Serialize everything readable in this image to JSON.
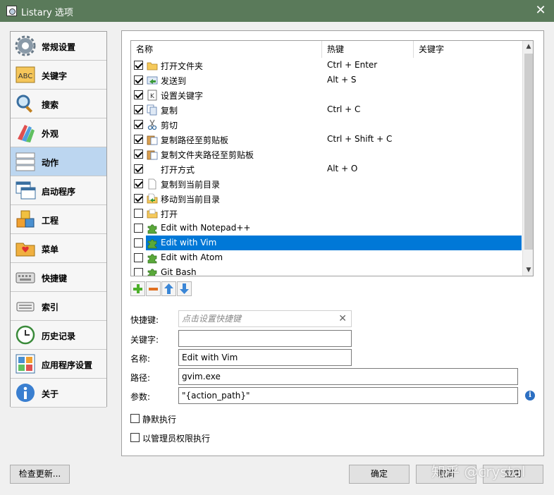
{
  "window": {
    "title": "Listary 选项",
    "close_glyph": "✕"
  },
  "sidebar": {
    "items": [
      {
        "label": "常规设置",
        "icon": "gear-icon"
      },
      {
        "label": "关键字",
        "icon": "abc-icon"
      },
      {
        "label": "搜索",
        "icon": "magnifier-icon"
      },
      {
        "label": "外观",
        "icon": "palette-icon"
      },
      {
        "label": "动作",
        "icon": "action-list-icon"
      },
      {
        "label": "启动程序",
        "icon": "windows-icon"
      },
      {
        "label": "工程",
        "icon": "boxes-icon"
      },
      {
        "label": "菜单",
        "icon": "folder-heart-icon"
      },
      {
        "label": "快捷键",
        "icon": "keyboard-icon"
      },
      {
        "label": "索引",
        "icon": "index-icon"
      },
      {
        "label": "历史记录",
        "icon": "clock-icon"
      },
      {
        "label": "应用程序设置",
        "icon": "app-settings-icon"
      },
      {
        "label": "关于",
        "icon": "info-icon"
      }
    ],
    "active_index": 4
  },
  "table": {
    "headers": [
      "名称",
      "热键",
      "关键字"
    ],
    "rows": [
      {
        "checked": true,
        "icon": "folder-icon",
        "name": "打开文件夹",
        "hotkey": "Ctrl + Enter"
      },
      {
        "checked": true,
        "icon": "send-to-icon",
        "name": "发送到",
        "hotkey": "Alt + S"
      },
      {
        "checked": true,
        "icon": "keyword-icon",
        "name": "设置关键字",
        "hotkey": ""
      },
      {
        "checked": true,
        "icon": "copy-icon",
        "name": "复制",
        "hotkey": "Ctrl + C"
      },
      {
        "checked": true,
        "icon": "scissors-icon",
        "name": "剪切",
        "hotkey": ""
      },
      {
        "checked": true,
        "icon": "clipboard-icon",
        "name": "复制路径至剪贴板",
        "hotkey": "Ctrl + Shift + C"
      },
      {
        "checked": true,
        "icon": "clipboard-icon",
        "name": "复制文件夹路径至剪贴板",
        "hotkey": ""
      },
      {
        "checked": true,
        "icon": "",
        "name": "打开方式",
        "hotkey": "Alt + O"
      },
      {
        "checked": true,
        "icon": "copy-file-icon",
        "name": "复制到当前目录",
        "hotkey": ""
      },
      {
        "checked": true,
        "icon": "move-file-icon",
        "name": "移动到当前目录",
        "hotkey": ""
      },
      {
        "checked": false,
        "icon": "open-folder-icon",
        "name": "打开",
        "hotkey": ""
      },
      {
        "checked": false,
        "icon": "puzzle-icon",
        "name": "Edit with Notepad++",
        "hotkey": ""
      },
      {
        "checked": false,
        "icon": "puzzle-icon",
        "name": "Edit with Vim",
        "hotkey": "",
        "selected": true
      },
      {
        "checked": false,
        "icon": "puzzle-icon",
        "name": "Edit with Atom",
        "hotkey": ""
      },
      {
        "checked": false,
        "icon": "puzzle-icon",
        "name": "Git Bash",
        "hotkey": ""
      }
    ],
    "scroll_up_glyph": "▲",
    "scroll_down_glyph": "▼"
  },
  "toolbar": [
    {
      "name": "add-button",
      "icon": "plus-icon"
    },
    {
      "name": "remove-button",
      "icon": "minus-icon"
    },
    {
      "name": "move-up-button",
      "icon": "arrow-up-icon"
    },
    {
      "name": "move-down-button",
      "icon": "arrow-down-icon"
    }
  ],
  "form": {
    "hotkey_label": "快捷键:",
    "hotkey_placeholder": "点击设置快捷键",
    "clear_glyph": "✕",
    "keyword_label": "关键字:",
    "keyword_value": "",
    "name_label": "名称:",
    "name_value": "Edit with Vim",
    "path_label": "路径:",
    "path_value": "gvim.exe",
    "args_label": "参数:",
    "args_value": "\"{action_path}\"",
    "info_glyph": "i",
    "silent_label": "静默执行",
    "silent_checked": false,
    "admin_label": "以管理员权限执行",
    "admin_checked": false
  },
  "buttons": {
    "check_update": "检查更新...",
    "ok": "确定",
    "cancel": "取消",
    "apply": "应用"
  },
  "watermark": "知乎 @crystal",
  "colors": {
    "titlebar": "#5a7a5a",
    "selection": "#0078d7",
    "sidebar_active": "#bcd6f0"
  }
}
